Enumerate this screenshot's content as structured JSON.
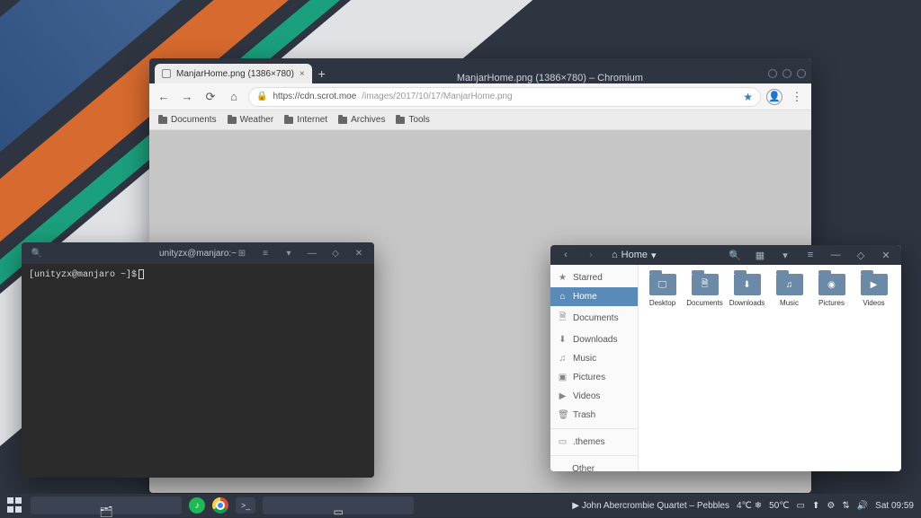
{
  "browser": {
    "window_title": "ManjarHome.png (1386×780) – Chromium",
    "tab_title": "ManjarHome.png (1386×780)",
    "url_host": "https://cdn.scrot.moe",
    "url_path": "/images/2017/10/17/ManjarHome.png",
    "bookmarks": [
      "Documents",
      "Weather",
      "Internet",
      "Archives",
      "Tools"
    ]
  },
  "terminal": {
    "title": "unityzx@manjaro:~",
    "prompt": "[unityzx@manjaro ~]$"
  },
  "filemanager": {
    "location_label": "Home",
    "sidebar": [
      {
        "label": "Starred",
        "icon": "★",
        "active": false
      },
      {
        "label": "Home",
        "icon": "⌂",
        "active": true
      },
      {
        "label": "Documents",
        "icon": "🗎",
        "active": false
      },
      {
        "label": "Downloads",
        "icon": "⬇",
        "active": false
      },
      {
        "label": "Music",
        "icon": "♫",
        "active": false
      },
      {
        "label": "Pictures",
        "icon": "▣",
        "active": false
      },
      {
        "label": "Videos",
        "icon": "▶",
        "active": false
      },
      {
        "label": "Trash",
        "icon": "🗑",
        "active": false
      }
    ],
    "sidebar_extra": [
      {
        "label": ".themes",
        "icon": "▭"
      }
    ],
    "other_locations": "Other Locations",
    "files": [
      {
        "name": "Desktop",
        "glyph": "🖵"
      },
      {
        "name": "Documents",
        "glyph": "🗎"
      },
      {
        "name": "Downloads",
        "glyph": "⬇"
      },
      {
        "name": "Music",
        "glyph": "♫"
      },
      {
        "name": "Pictures",
        "glyph": "◉"
      },
      {
        "name": "Videos",
        "glyph": "▶"
      }
    ]
  },
  "panel": {
    "now_playing": "John Abercrombie Quartet – Pebbles",
    "weather": "4℃",
    "cpu_temp": "50℃",
    "clock": "Sat 09:59"
  }
}
